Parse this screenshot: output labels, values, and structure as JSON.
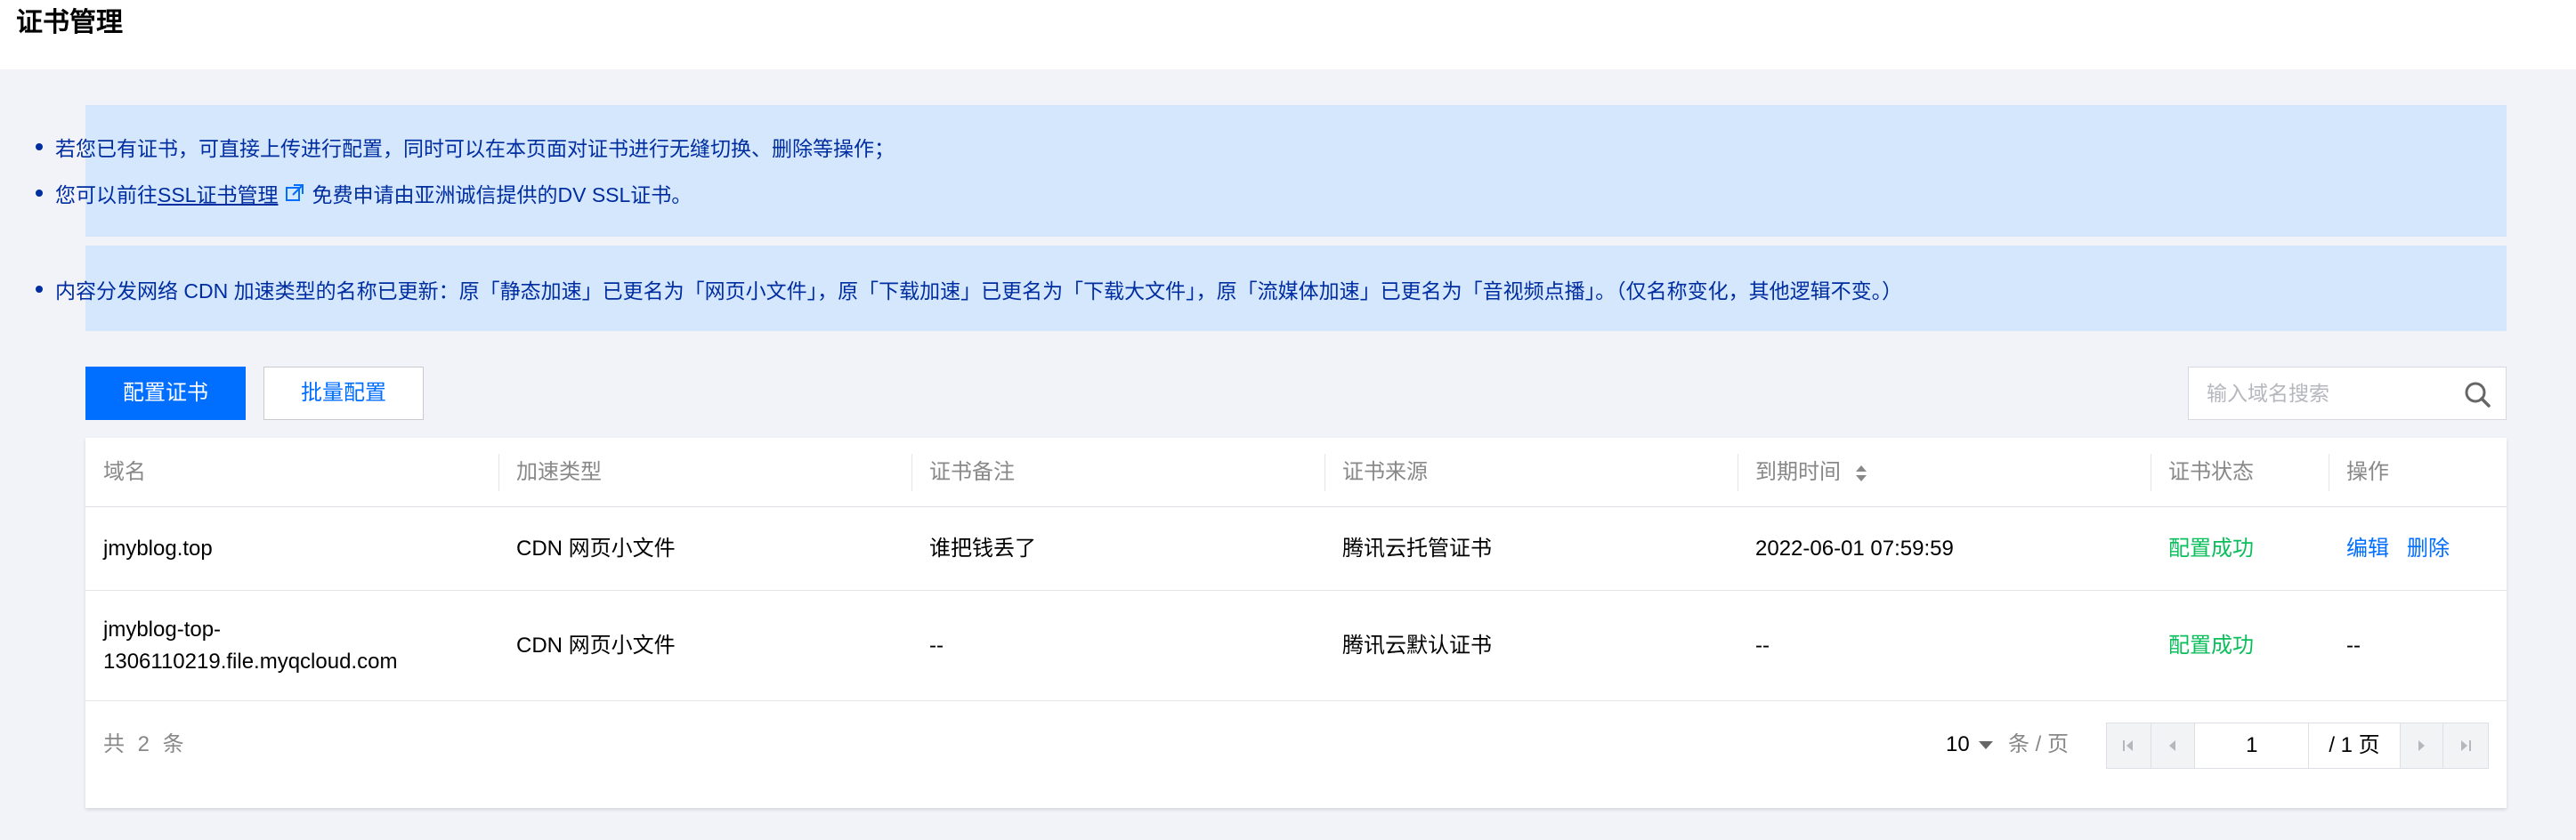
{
  "page": {
    "title": "证书管理"
  },
  "notices": {
    "line1": "若您已有证书，可直接上传进行配置，同时可以在本页面对证书进行无缝切换、删除等操作；",
    "line2_prefix": "您可以前往",
    "line2_link": "SSL证书管理",
    "line2_suffix": "免费申请由亚洲诚信提供的DV SSL证书。",
    "line3": "内容分发网络 CDN 加速类型的名称已更新：原「静态加速」已更名为「网页小文件」，原「下载加速」已更名为「下载大文件」，原「流媒体加速」已更名为「音视频点播」。（仅名称变化，其他逻辑不变。）"
  },
  "toolbar": {
    "config_label": "配置证书",
    "batch_label": "批量配置",
    "search_placeholder": "输入域名搜索"
  },
  "table": {
    "headers": [
      "域名",
      "加速类型",
      "证书备注",
      "证书来源",
      "到期时间",
      "证书状态",
      "操作"
    ],
    "rows": [
      {
        "domain": "jmyblog.top",
        "type": "CDN 网页小文件",
        "remark": "谁把钱丢了",
        "source": "腾讯云托管证书",
        "expire": "2022-06-01 07:59:59",
        "status": "配置成功",
        "action_edit": "编辑",
        "action_delete": "删除"
      },
      {
        "domain_line1": "jmyblog-top-",
        "domain_line2": "1306110219.file.myqcloud.com",
        "type": "CDN 网页小文件",
        "remark": "--",
        "source": "腾讯云默认证书",
        "expire": "--",
        "status": "配置成功",
        "action": "--"
      }
    ]
  },
  "pagination": {
    "total": "共 2 条",
    "page_size": "10",
    "per_page": "条 / 页",
    "current_page": "1",
    "total_pages": "/ 1 页"
  },
  "colors": {
    "primary": "#006eff",
    "success": "#0abf5b",
    "notice_bg": "#d5e7fd",
    "notice_text": "#002da0"
  },
  "icons": {
    "external_link": "external-link-icon",
    "search": "search-icon",
    "sort": "sort-icon"
  }
}
